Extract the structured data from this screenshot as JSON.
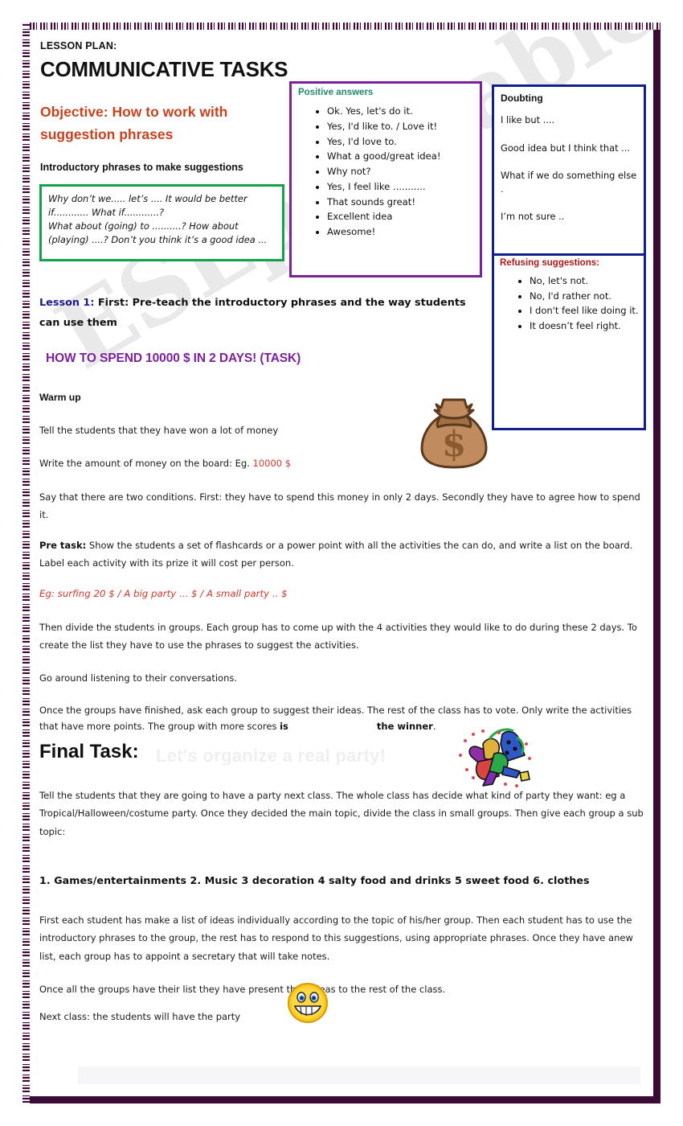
{
  "header": {
    "lesson_plan_label": "LESSON PLAN:",
    "title": "COMMUNICATIVE TASKS",
    "objective": "Objective: How to work with suggestion phrases",
    "intro_heading": "Introductory phrases to make suggestions"
  },
  "intro_box": {
    "lines": [
      "Why don’t we.....   let’s  ....    It would be better if............ What if............?",
      "What about (going) to ..........? How about (playing) ....?  Don’t you think it’s a good idea ..."
    ]
  },
  "positive_box": {
    "title": "Positive answers",
    "items": [
      "Ok. Yes, let's do it.",
      "Yes, I'd like to. / Love it!",
      "Yes, I'd love to.",
      "What a good/great  idea!",
      "Why not?",
      "Yes, I feel like ...........",
      "That sounds great!",
      "Excellent idea",
      "Awesome!"
    ]
  },
  "doubting_box": {
    "title": "Doubting",
    "items": [
      "I like but ....",
      "Good idea but I think that ...",
      "What if we do something else .",
      "I’m not sure .."
    ]
  },
  "refusing_box": {
    "title": "Refusing suggestions:",
    "items": [
      "No, let's not.",
      "No, I'd rather not.",
      "I don't feel like doing it.",
      "It doesn’t feel right."
    ]
  },
  "lesson": {
    "tag": "Lesson 1:",
    "text": " First: Pre-teach the introductory phrases and the way students can use them",
    "task_title": "HOW TO SPEND 10000 $ IN 2 DAYS! (TASK)",
    "warm_up_heading": "Warm up"
  },
  "paragraphs": {
    "p1": "Tell the students that they have won a lot of money",
    "p2_pre": "Write the amount of money on the board: Eg. ",
    "p2_amount": "10000 $",
    "p3": "Say that there are two conditions. First: they have to spend this money in only 2 days. Secondly they have to agree how to spend it.",
    "p4_label": "Pre task:",
    "p4_text": " Show the students a set of flashcards or a power point with all the activities the can do, and write a list on the board. Label each activity with its prize it will cost per person.",
    "p5_example": "Eg: surfing 20 $   / A big party ... $      /    A small party .. $",
    "p6": "Then divide the students in groups. Each group has to come up with the 4 activities they would like to do during these 2 days. To create the list they have to use the phrases to suggest the activities.",
    "p7": "Go around listening to their conversations.",
    "p8_a": "Once the groups have finished, ask each group to suggest their ideas. The rest of the class has to vote. Only write the activities that have more points. The group with more scores ",
    "p8_bold1": "is",
    "p8_bold2": "the winner",
    "p8_end": ".",
    "p9": "Tell the students that they are going to have a party next class. The whole class has decide what kind of party they want: eg a Tropical/Halloween/costume party.  Once they decided the main topic, divide the class in small groups. Then give each group a sub topic:",
    "p10": "First each student has make a list of ideas individually according to the topic of his/her group. Then each student has to use the introductory phrases to the group, the rest has to respond to this suggestions, using appropriate phrases. Once they have anew list, each group has to appoint a secretary that will take notes.",
    "p11": "Once all the groups have their list they have present their ideas to the rest of the class.",
    "p12": "Next class: the students will have the party"
  },
  "final_task": {
    "label": "Final Task:",
    "subtitle": "Let's organize a real party!",
    "subtopics": "1.  Games/entertainments 2.  Music 3 decoration 4 salty food and drinks 5 sweet  food 6.  clothes"
  },
  "watermark": {
    "text": "ESLprintables.com"
  },
  "colors": {
    "objective_red": "#c8421e",
    "task_purple": "#7b219f",
    "lesson_navy": "#1a1a8f",
    "green_border": "#12a24a",
    "purple_border": "#7b219f",
    "navy_border": "#111f8f",
    "positive_title_green": "#1e8a6e",
    "refusing_red": "#b01818",
    "frame_purple": "#3b0b36"
  }
}
